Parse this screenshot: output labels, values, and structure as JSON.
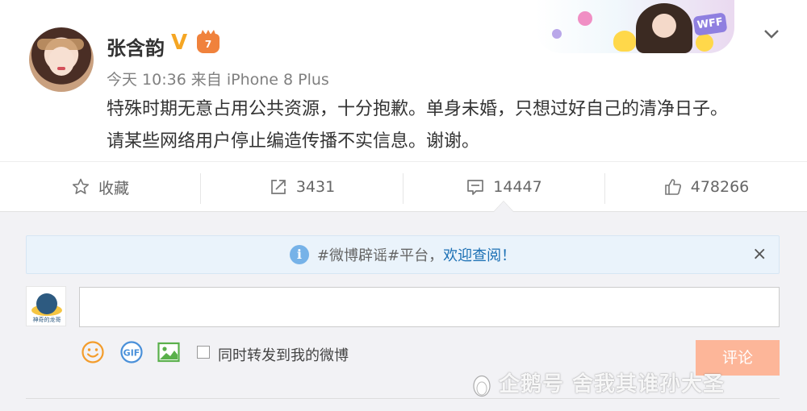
{
  "post": {
    "username": "张含韵",
    "verify_badge": "V",
    "crown_badge_level": "7",
    "time": "今天 10:36",
    "source": "来自 iPhone 8 Plus",
    "line1": "特殊时期无意占用公共资源，十分抱歉。单身未婚，只想过好自己的清净日子。",
    "line2": "请某些网络用户停止编造传播不实信息。谢谢。"
  },
  "banner": {
    "badge_text": "WFF"
  },
  "actions": {
    "favorite_label": "收藏",
    "forward_count": "3431",
    "comment_count": "14447",
    "like_count": "478266"
  },
  "notice": {
    "info_glyph": "i",
    "prefix": "#微博辟谣#平台，",
    "link_text": "欢迎查阅！",
    "close_glyph": "×"
  },
  "comment_box": {
    "input_value": "",
    "avatar_text": "神奇的龙哥",
    "repost_label": "同时转发到我的微博",
    "repost_checked": false,
    "submit_label": "评论"
  },
  "watermark": {
    "text": "企鹅号 舍我其谁孙大圣"
  },
  "colors": {
    "accent_orange": "#f5a623",
    "submit_disabled": "#fdb699",
    "link_blue": "#1a6fb4",
    "notice_bg": "#eaf3fb",
    "comment_area_bg": "#f2f2f5"
  },
  "icons": [
    "chevron-down-icon",
    "star-icon",
    "forward-icon",
    "comment-icon",
    "thumbs-up-icon",
    "info-icon",
    "close-icon",
    "emoji-icon",
    "gif-icon",
    "image-icon",
    "penguin-icon"
  ]
}
